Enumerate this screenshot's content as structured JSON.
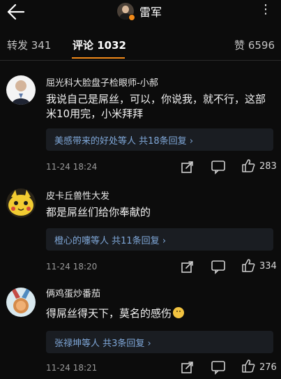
{
  "header": {
    "title": "雷军"
  },
  "tabs": [
    {
      "label": "转发 341"
    },
    {
      "label": "评论 1032"
    },
    {
      "label": "赞 6596"
    }
  ],
  "comments": [
    {
      "author": "屈光科大脸盘子检眼师-小郝",
      "text": "我说自己是屌丝，可以，你说我，就不行，这部米10用完，小米拜拜",
      "reply_summary": "美感带来的好处等人  共18条回复",
      "time": "11-24 18:24",
      "likes": "283"
    },
    {
      "author": "皮卡丘兽性大发",
      "text": "都是屌丝们给你奉献的",
      "reply_summary": "橙心的嚏等人  共11条回复",
      "time": "11-24 18:20",
      "likes": "334"
    },
    {
      "author": "俩鸡蛋炒番茄",
      "text": "得屌丝得天下，莫名的感伤",
      "reply_summary": "张禄坤等人  共3条回复",
      "time": "11-24 18:21",
      "likes": "276"
    }
  ],
  "icons": {
    "back": "arrow-left-icon",
    "more": "more-dots-icon",
    "share": "share-icon",
    "comment": "comment-icon",
    "like": "thumb-up-icon",
    "chevron": "chevron-right-icon"
  },
  "colors": {
    "background": "#0c0c0c",
    "accent": "#f28a19",
    "reply_link": "#7fa7d8",
    "reply_box": "#1a1d22"
  }
}
